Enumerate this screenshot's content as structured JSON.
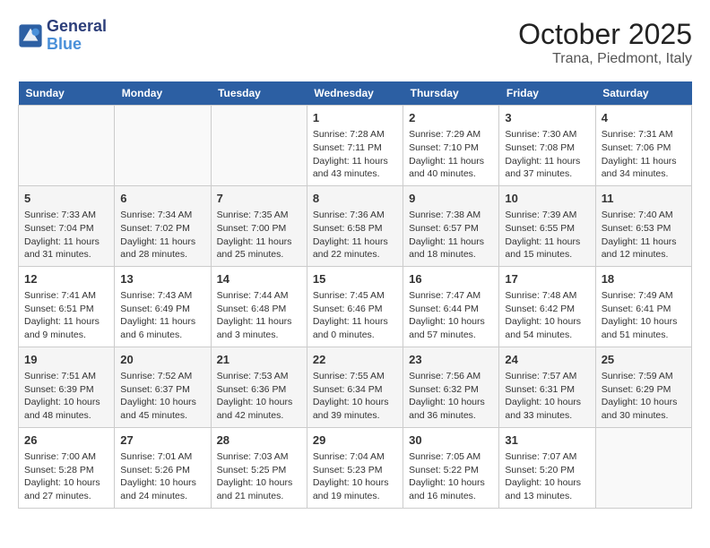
{
  "header": {
    "logo_line1": "General",
    "logo_line2": "Blue",
    "title": "October 2025",
    "subtitle": "Trana, Piedmont, Italy"
  },
  "days_of_week": [
    "Sunday",
    "Monday",
    "Tuesday",
    "Wednesday",
    "Thursday",
    "Friday",
    "Saturday"
  ],
  "weeks": [
    [
      {
        "day": "",
        "info": ""
      },
      {
        "day": "",
        "info": ""
      },
      {
        "day": "",
        "info": ""
      },
      {
        "day": "1",
        "info": "Sunrise: 7:28 AM\nSunset: 7:11 PM\nDaylight: 11 hours and 43 minutes."
      },
      {
        "day": "2",
        "info": "Sunrise: 7:29 AM\nSunset: 7:10 PM\nDaylight: 11 hours and 40 minutes."
      },
      {
        "day": "3",
        "info": "Sunrise: 7:30 AM\nSunset: 7:08 PM\nDaylight: 11 hours and 37 minutes."
      },
      {
        "day": "4",
        "info": "Sunrise: 7:31 AM\nSunset: 7:06 PM\nDaylight: 11 hours and 34 minutes."
      }
    ],
    [
      {
        "day": "5",
        "info": "Sunrise: 7:33 AM\nSunset: 7:04 PM\nDaylight: 11 hours and 31 minutes."
      },
      {
        "day": "6",
        "info": "Sunrise: 7:34 AM\nSunset: 7:02 PM\nDaylight: 11 hours and 28 minutes."
      },
      {
        "day": "7",
        "info": "Sunrise: 7:35 AM\nSunset: 7:00 PM\nDaylight: 11 hours and 25 minutes."
      },
      {
        "day": "8",
        "info": "Sunrise: 7:36 AM\nSunset: 6:58 PM\nDaylight: 11 hours and 22 minutes."
      },
      {
        "day": "9",
        "info": "Sunrise: 7:38 AM\nSunset: 6:57 PM\nDaylight: 11 hours and 18 minutes."
      },
      {
        "day": "10",
        "info": "Sunrise: 7:39 AM\nSunset: 6:55 PM\nDaylight: 11 hours and 15 minutes."
      },
      {
        "day": "11",
        "info": "Sunrise: 7:40 AM\nSunset: 6:53 PM\nDaylight: 11 hours and 12 minutes."
      }
    ],
    [
      {
        "day": "12",
        "info": "Sunrise: 7:41 AM\nSunset: 6:51 PM\nDaylight: 11 hours and 9 minutes."
      },
      {
        "day": "13",
        "info": "Sunrise: 7:43 AM\nSunset: 6:49 PM\nDaylight: 11 hours and 6 minutes."
      },
      {
        "day": "14",
        "info": "Sunrise: 7:44 AM\nSunset: 6:48 PM\nDaylight: 11 hours and 3 minutes."
      },
      {
        "day": "15",
        "info": "Sunrise: 7:45 AM\nSunset: 6:46 PM\nDaylight: 11 hours and 0 minutes."
      },
      {
        "day": "16",
        "info": "Sunrise: 7:47 AM\nSunset: 6:44 PM\nDaylight: 10 hours and 57 minutes."
      },
      {
        "day": "17",
        "info": "Sunrise: 7:48 AM\nSunset: 6:42 PM\nDaylight: 10 hours and 54 minutes."
      },
      {
        "day": "18",
        "info": "Sunrise: 7:49 AM\nSunset: 6:41 PM\nDaylight: 10 hours and 51 minutes."
      }
    ],
    [
      {
        "day": "19",
        "info": "Sunrise: 7:51 AM\nSunset: 6:39 PM\nDaylight: 10 hours and 48 minutes."
      },
      {
        "day": "20",
        "info": "Sunrise: 7:52 AM\nSunset: 6:37 PM\nDaylight: 10 hours and 45 minutes."
      },
      {
        "day": "21",
        "info": "Sunrise: 7:53 AM\nSunset: 6:36 PM\nDaylight: 10 hours and 42 minutes."
      },
      {
        "day": "22",
        "info": "Sunrise: 7:55 AM\nSunset: 6:34 PM\nDaylight: 10 hours and 39 minutes."
      },
      {
        "day": "23",
        "info": "Sunrise: 7:56 AM\nSunset: 6:32 PM\nDaylight: 10 hours and 36 minutes."
      },
      {
        "day": "24",
        "info": "Sunrise: 7:57 AM\nSunset: 6:31 PM\nDaylight: 10 hours and 33 minutes."
      },
      {
        "day": "25",
        "info": "Sunrise: 7:59 AM\nSunset: 6:29 PM\nDaylight: 10 hours and 30 minutes."
      }
    ],
    [
      {
        "day": "26",
        "info": "Sunrise: 7:00 AM\nSunset: 5:28 PM\nDaylight: 10 hours and 27 minutes."
      },
      {
        "day": "27",
        "info": "Sunrise: 7:01 AM\nSunset: 5:26 PM\nDaylight: 10 hours and 24 minutes."
      },
      {
        "day": "28",
        "info": "Sunrise: 7:03 AM\nSunset: 5:25 PM\nDaylight: 10 hours and 21 minutes."
      },
      {
        "day": "29",
        "info": "Sunrise: 7:04 AM\nSunset: 5:23 PM\nDaylight: 10 hours and 19 minutes."
      },
      {
        "day": "30",
        "info": "Sunrise: 7:05 AM\nSunset: 5:22 PM\nDaylight: 10 hours and 16 minutes."
      },
      {
        "day": "31",
        "info": "Sunrise: 7:07 AM\nSunset: 5:20 PM\nDaylight: 10 hours and 13 minutes."
      },
      {
        "day": "",
        "info": ""
      }
    ]
  ]
}
